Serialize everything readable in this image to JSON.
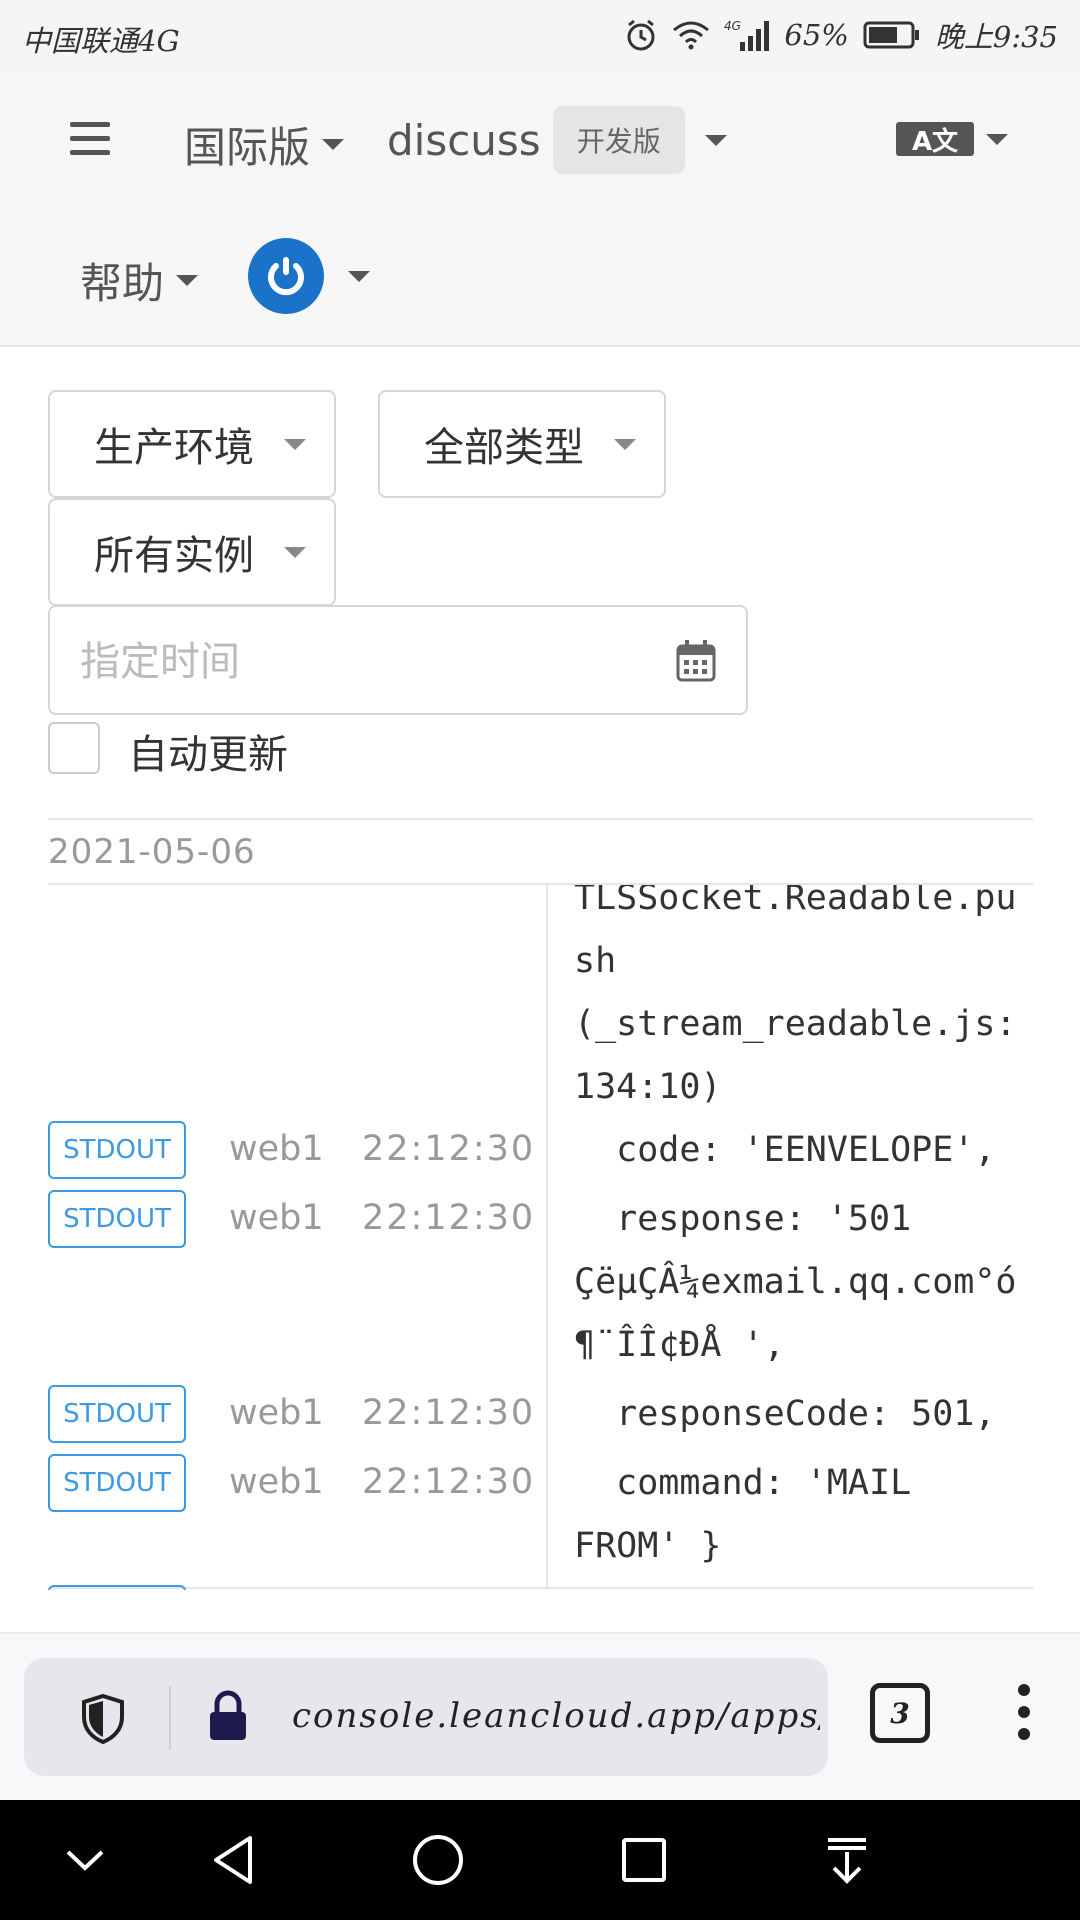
{
  "statusbar": {
    "carrier": "中国联通4G",
    "battery": "65%",
    "time": "晚上9:35",
    "icons": [
      "alarm-icon",
      "wifi-icon",
      "signal-4g-icon",
      "battery-icon"
    ]
  },
  "header": {
    "region": "国际版",
    "app_name": "discuss",
    "plan_badge": "开发版",
    "language_icon_text": "A文",
    "help": "帮助"
  },
  "filters": {
    "environment": "生产环境",
    "type": "全部类型",
    "instance": "所有实例",
    "time_placeholder": "指定时间",
    "auto_update_label": "自动更新",
    "auto_update_checked": false
  },
  "log": {
    "date": "2021-05-06",
    "continuation": "TLSSocket.Readable.pu\nsh\n(_stream_readable.js:\n134:10)",
    "entries": [
      {
        "stream": "STDOUT",
        "instance": "web1",
        "time": "22:12:30",
        "message": "  code: 'EENVELOPE',"
      },
      {
        "stream": "STDOUT",
        "instance": "web1",
        "time": "22:12:30",
        "message": "  response: '501\nÇëµÇÂ¼exmail.qq.com°ó\n¶¨ÎÎ¢ÐÅ ',"
      },
      {
        "stream": "STDOUT",
        "instance": "web1",
        "time": "22:12:30",
        "message": "  responseCode: 501,"
      },
      {
        "stream": "STDOUT",
        "instance": "web1",
        "time": "22:12:30",
        "message": "  command: 'MAIL\nFROM' }"
      }
    ]
  },
  "browser": {
    "url": "console.leancloud.app/apps/AofFx",
    "tab_count": "3"
  },
  "colors": {
    "accent": "#3b9ae1",
    "avatar": "#1a73c8"
  }
}
